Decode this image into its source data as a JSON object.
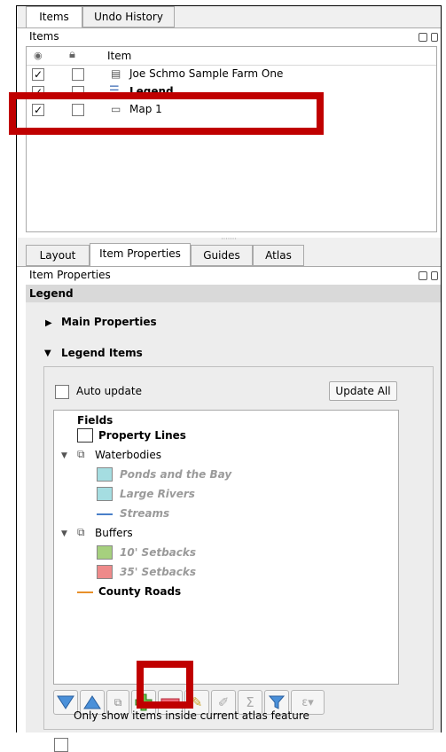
{
  "top_tabs": [
    {
      "label": "Items"
    },
    {
      "label": "Undo History"
    }
  ],
  "items_panel": {
    "title": "Items",
    "column_item": "Item",
    "rows": [
      {
        "label": "Joe Schmo Sample Farm One",
        "checked": true
      },
      {
        "label": "Legend",
        "checked": true
      },
      {
        "label": "Map 1",
        "checked": true
      }
    ]
  },
  "bottom_tabs": [
    {
      "label": "Layout"
    },
    {
      "label": "Item Properties"
    },
    {
      "label": "Guides"
    },
    {
      "label": "Atlas"
    }
  ],
  "item_properties": {
    "title": "Item Properties",
    "section": "Legend",
    "main_properties": "Main Properties",
    "legend_items": "Legend Items",
    "auto_update": "Auto update",
    "update_all": "Update All",
    "only_show_atlas": "Only show items inside current atlas feature"
  },
  "legend_tree": {
    "fields": "Fields",
    "property_lines": "Property Lines",
    "waterbodies": "Waterbodies",
    "ponds": "Ponds and the Bay",
    "large_rivers": "Large Rivers",
    "streams": "Streams",
    "buffers": "Buffers",
    "setback10": "10' Setbacks",
    "setback35": "35' Setbacks",
    "county_roads": "County Roads"
  },
  "colors": {
    "highlight": "#c00000",
    "water": "#a5dde1",
    "setback10": "#a6d07e",
    "setback35": "#ee8a8a",
    "road": "#e8902a",
    "stream": "#4a7fc9"
  }
}
